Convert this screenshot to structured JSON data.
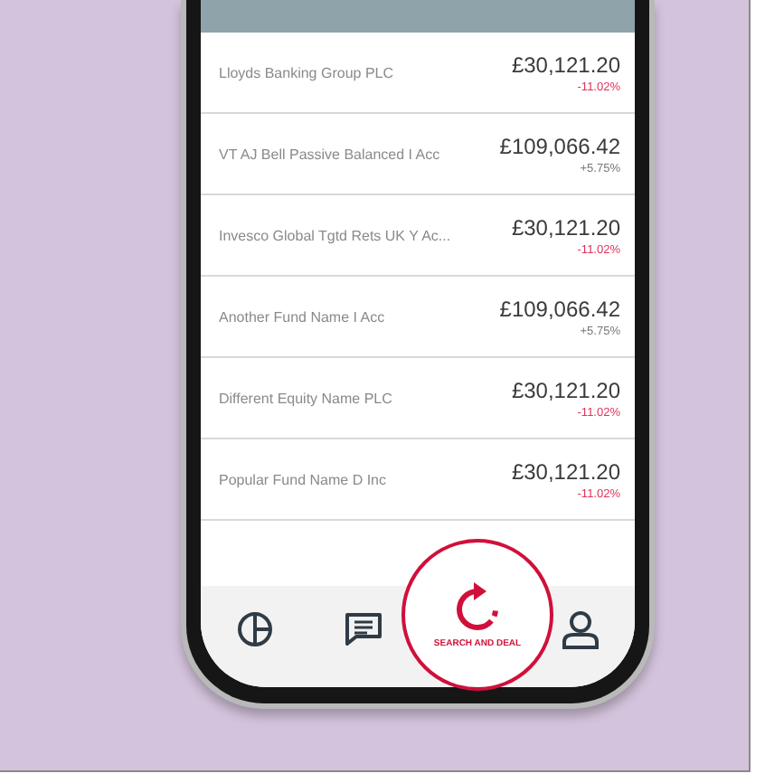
{
  "holdings": [
    {
      "name": "Lloyds Banking Group PLC",
      "value": "£30,121.20",
      "change": "-11.02%",
      "negative": true
    },
    {
      "name": "VT AJ Bell Passive Balanced I Acc",
      "value": "£109,066.42",
      "change": "+5.75%",
      "negative": false
    },
    {
      "name": "Invesco Global Tgtd Rets UK Y Ac...",
      "value": "£30,121.20",
      "change": "-11.02%",
      "negative": true
    },
    {
      "name": "Another Fund Name I Acc",
      "value": "£109,066.42",
      "change": "+5.75%",
      "negative": false
    },
    {
      "name": "Different Equity Name PLC",
      "value": "£30,121.20",
      "change": "-11.02%",
      "negative": true
    },
    {
      "name": "Popular Fund Name D Inc",
      "value": "£30,121.20",
      "change": "-11.02%",
      "negative": true
    }
  ],
  "nav": [
    {
      "kind": "portfolio",
      "selected": false
    },
    {
      "kind": "messages",
      "selected": false
    },
    {
      "kind": "search",
      "label": "SEARCH AND DEAL",
      "selected": true
    },
    {
      "kind": "account",
      "selected": false
    }
  ]
}
